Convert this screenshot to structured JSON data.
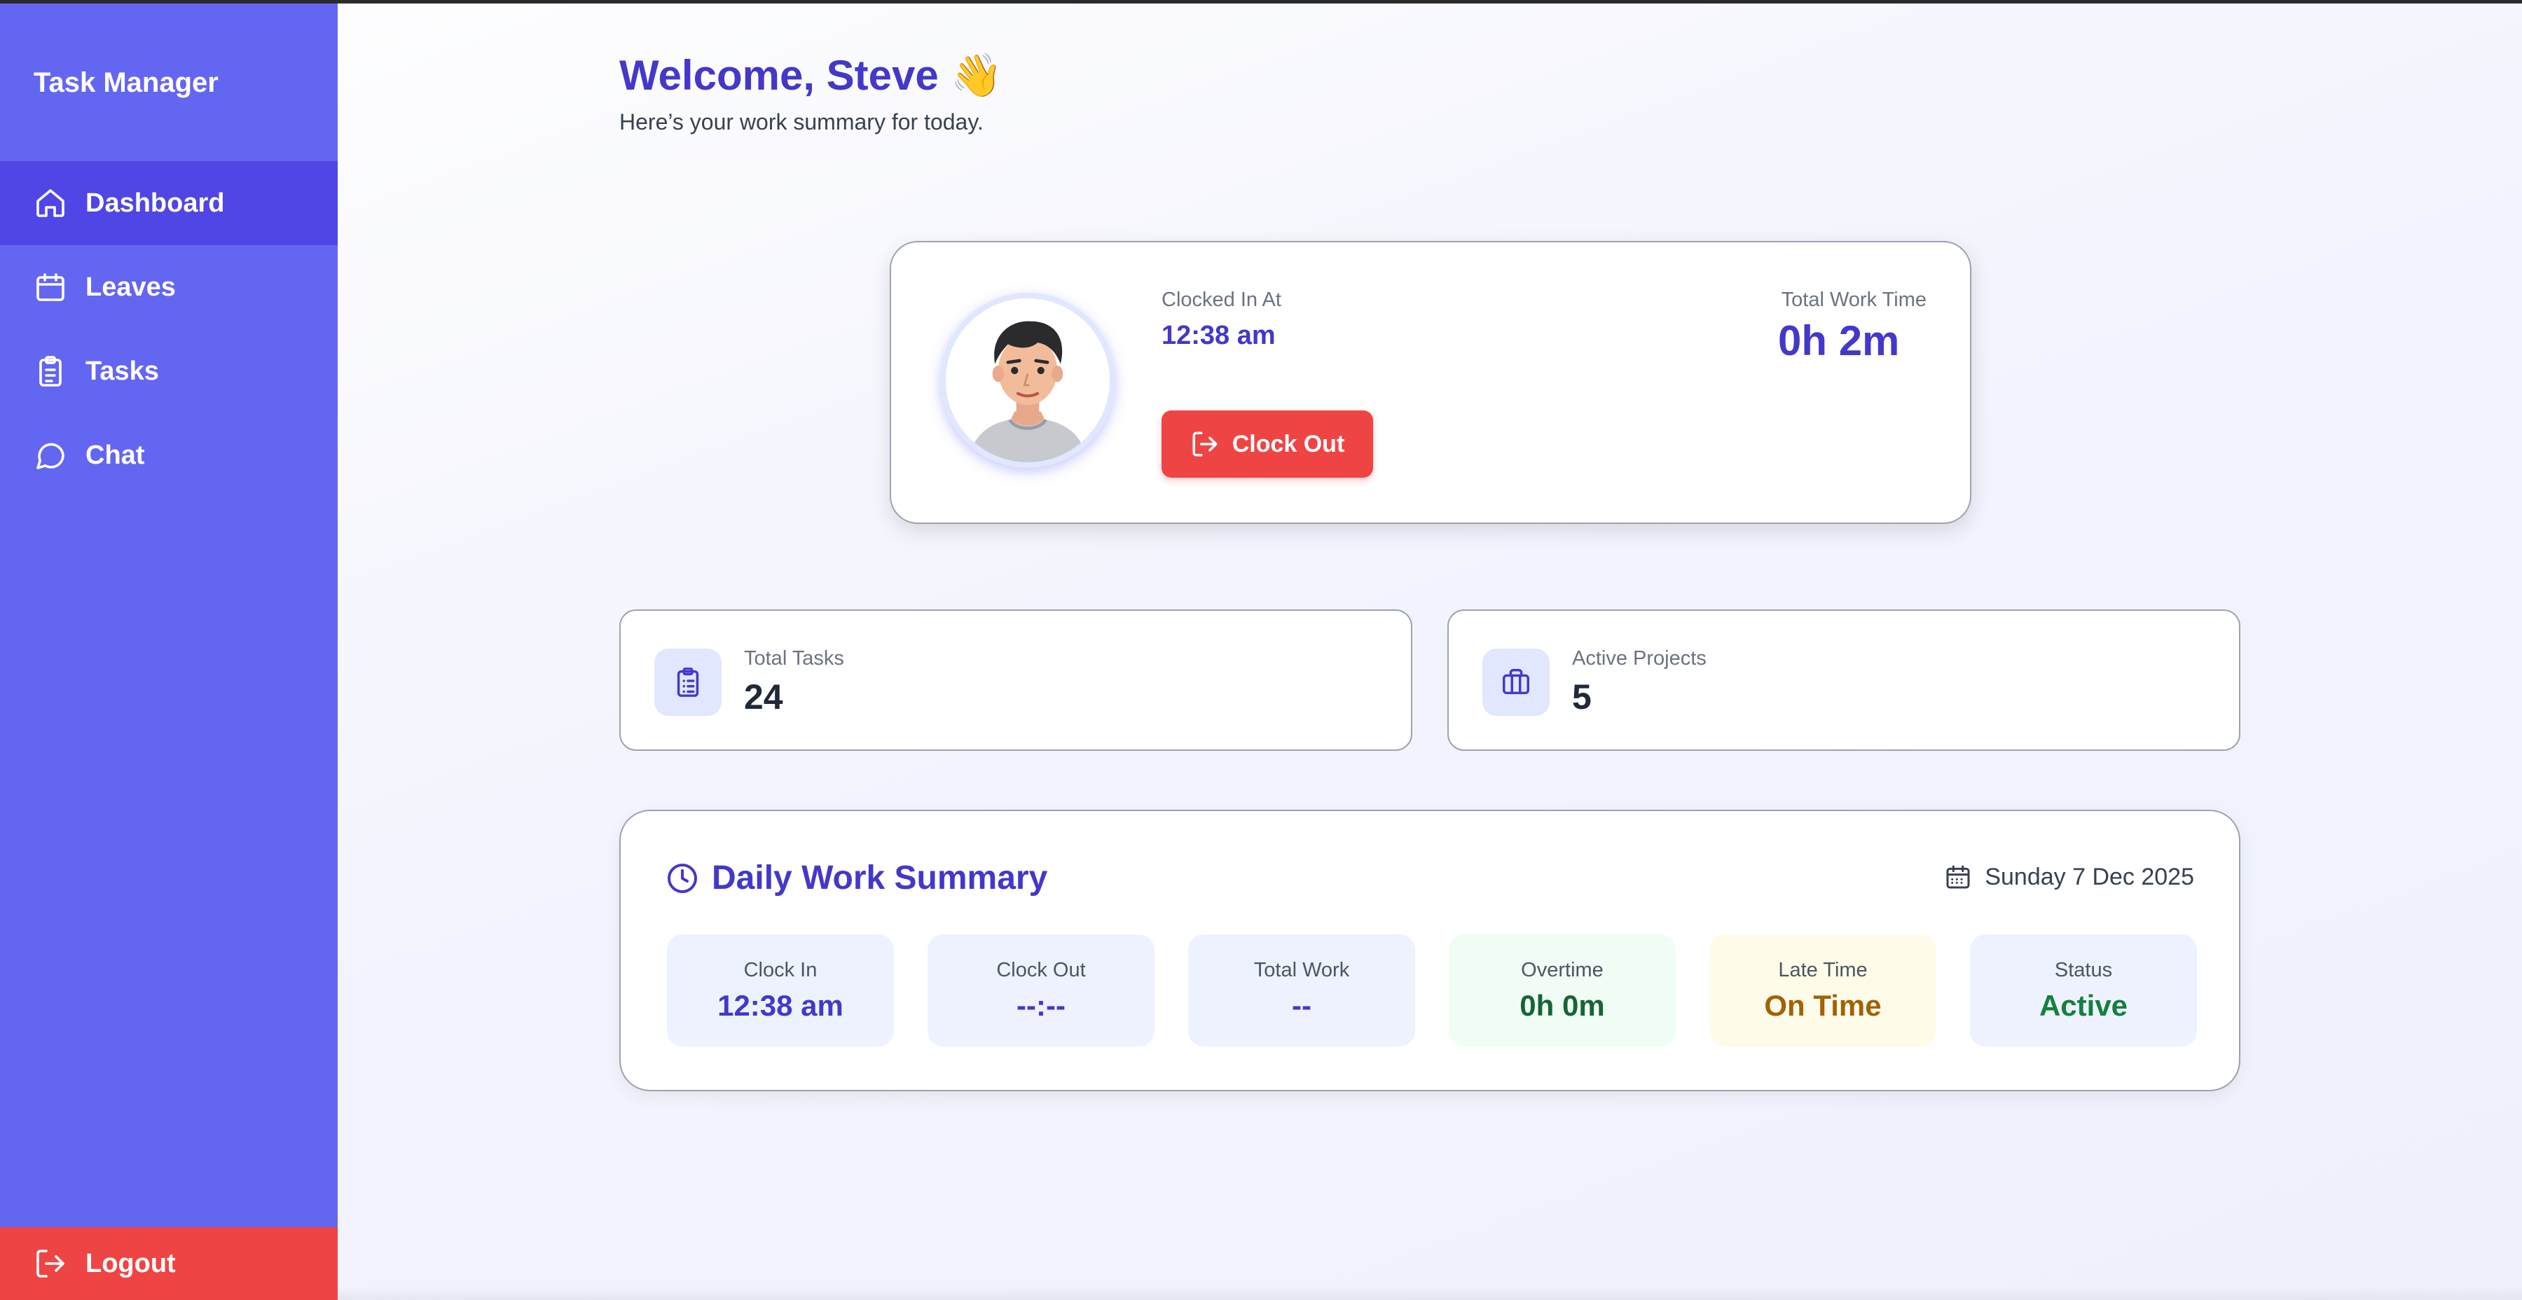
{
  "app": {
    "title": "Task Manager"
  },
  "sidebar": {
    "items": [
      {
        "label": "Dashboard",
        "icon": "home-icon",
        "active": true
      },
      {
        "label": "Leaves",
        "icon": "calendar-icon",
        "active": false
      },
      {
        "label": "Tasks",
        "icon": "clipboard-icon",
        "active": false
      },
      {
        "label": "Chat",
        "icon": "chat-bubble-icon",
        "active": false
      }
    ],
    "logout_label": "Logout"
  },
  "header": {
    "welcome": "Welcome, Steve 👋",
    "subtitle": "Here’s your work summary for today."
  },
  "clock_card": {
    "clocked_in_label": "Clocked In At",
    "clocked_in_value": "12:38 am",
    "total_work_label": "Total Work Time",
    "total_work_value": "0h 2m",
    "clock_out_label": "Clock Out"
  },
  "stats": [
    {
      "label": "Total Tasks",
      "value": "24",
      "icon": "clipboard-icon"
    },
    {
      "label": "Active Projects",
      "value": "5",
      "icon": "briefcase-icon"
    }
  ],
  "summary": {
    "title": "Daily Work Summary",
    "date": "Sunday 7 Dec 2025",
    "tiles": [
      {
        "label": "Clock In",
        "value": "12:38 am"
      },
      {
        "label": "Clock Out",
        "value": "--:--"
      },
      {
        "label": "Total Work",
        "value": "--"
      },
      {
        "label": "Overtime",
        "value": "0h 0m"
      },
      {
        "label": "Late Time",
        "value": "On Time"
      },
      {
        "label": "Status",
        "value": "Active"
      }
    ]
  },
  "colors": {
    "sidebar": "#6366f1",
    "sidebar_active": "#4f46e5",
    "accent": "#4338ca",
    "danger": "#ef4444",
    "success": "#166534",
    "warning": "#a16207"
  }
}
